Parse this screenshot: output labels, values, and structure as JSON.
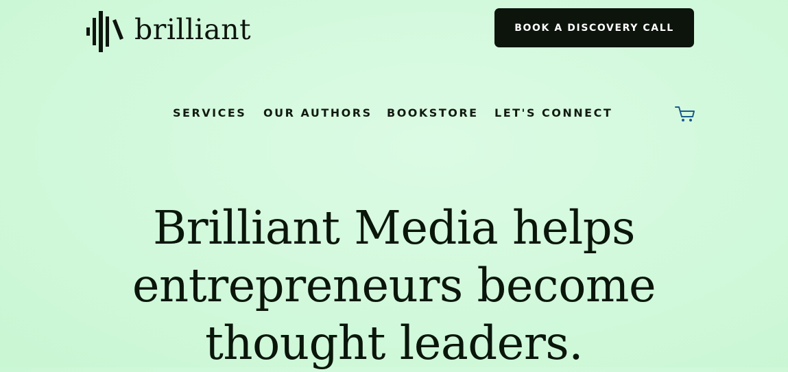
{
  "brand": {
    "name": "brilliant",
    "color": "#0d140d"
  },
  "header": {
    "cta_label": "BOOK A DISCOVERY CALL"
  },
  "nav": {
    "items": [
      {
        "label": "SERVICES"
      },
      {
        "label": "OUR AUTHORS"
      },
      {
        "label": "BOOKSTORE"
      },
      {
        "label": "LET'S CONNECT"
      }
    ],
    "cart_icon": "shopping-cart-icon"
  },
  "hero": {
    "lines": [
      "Brilliant Media helps",
      "entrepreneurs become",
      "thought leaders."
    ]
  },
  "colors": {
    "background": "#d3f9dd",
    "text": "#0d1a0d",
    "button_bg": "#0c140c",
    "button_text": "#ffffff",
    "cart_icon": "#1a5a8a"
  }
}
